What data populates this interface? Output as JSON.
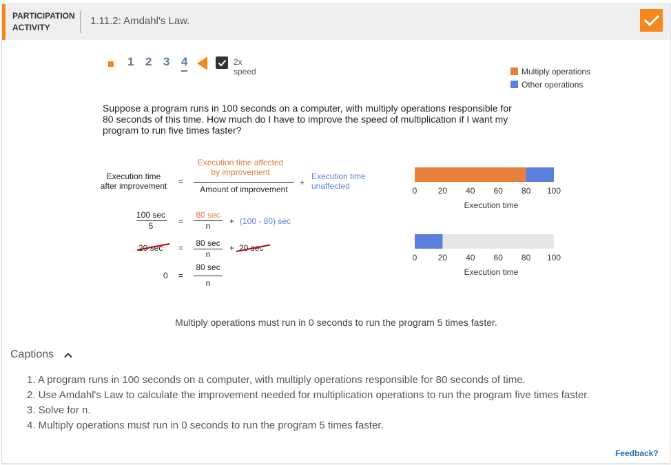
{
  "header": {
    "activity_line1": "PARTICIPATION",
    "activity_line2": "ACTIVITY",
    "title": "1.11.2: Amdahl's Law."
  },
  "controls": {
    "steps": [
      "1",
      "2",
      "3",
      "4"
    ],
    "active_step": "4",
    "speed_label": "2x speed",
    "speed_checked": true
  },
  "legend": [
    {
      "label": "Multiply operations",
      "color": "#e8803d"
    },
    {
      "label": "Other operations",
      "color": "#5b7fdb"
    }
  ],
  "problem_text": "Suppose a program runs in 100 seconds on a computer, with multiply operations responsible for 80 seconds of this time. How much do I have to improve the speed of multiplication if I want my program to run five times faster?",
  "equation": {
    "lhs_line1": "Execution time",
    "lhs_line2": "after improvement",
    "eq": "=",
    "affected_line1": "Execution time affected",
    "affected_line2": "by improvement",
    "amount": "Amount of improvement",
    "plus": "+",
    "unaffected_line1": "Execution time",
    "unaffected_line2": "unaffected",
    "row2_num": "100 sec",
    "row2_den": "5",
    "row2_affected": "80 sec",
    "row2_n": "n",
    "row2_unaffected": "(100 - 80) sec",
    "row3_lhs": "20 sec",
    "row3_num": "80 sec",
    "row3_n": "n",
    "row3_rhs": "20 sec",
    "row4_lhs": "0",
    "row4_num": "80 sec",
    "row4_n": "n"
  },
  "chart_data": [
    {
      "type": "bar",
      "orientation": "horizontal",
      "stacked": true,
      "xlabel": "Execution time",
      "xlim": [
        0,
        100
      ],
      "xticks": [
        0,
        20,
        40,
        60,
        80,
        100
      ],
      "series": [
        {
          "name": "Multiply operations",
          "values": [
            80
          ],
          "color": "#e8803d"
        },
        {
          "name": "Other operations",
          "values": [
            20
          ],
          "color": "#5b7fdb"
        }
      ]
    },
    {
      "type": "bar",
      "orientation": "horizontal",
      "stacked": true,
      "xlabel": "Execution time",
      "xlim": [
        0,
        100
      ],
      "xticks": [
        0,
        20,
        40,
        60,
        80,
        100
      ],
      "series": [
        {
          "name": "Other operations",
          "values": [
            20
          ],
          "color": "#5b7fdb"
        }
      ]
    }
  ],
  "result_text": "Multiply operations must run in 0 seconds to run the program 5 times faster.",
  "captions": {
    "toggle_label": "Captions",
    "items": [
      "1. A program runs in 100 seconds on a computer, with multiply operations responsible for 80 seconds of time.",
      "2. Use Amdahl's Law to calculate the improvement needed for multiplication operations to run the program five times faster.",
      "3. Solve for n.",
      "4. Multiply operations must run in 0 seconds to run the program 5 times faster."
    ]
  },
  "feedback_label": "Feedback?",
  "icons": {
    "done": "checkmark-icon",
    "back": "play-back-icon",
    "toggle": "chevron-up-icon"
  }
}
